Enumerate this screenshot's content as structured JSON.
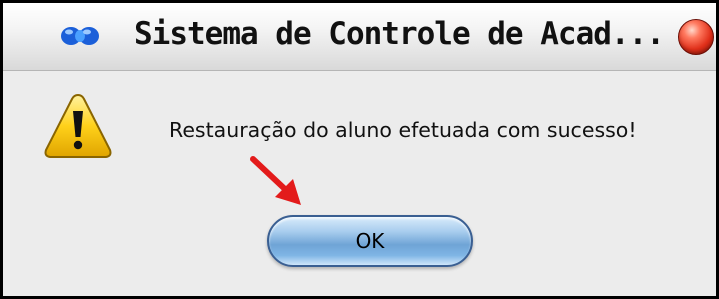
{
  "window": {
    "title": "Sistema de Controle de Acad...",
    "app_icon": "app-logo-icon",
    "close_icon": "close-icon"
  },
  "dialog": {
    "icon": "warning-icon",
    "message": "Restauração do aluno efetuada com sucesso!",
    "ok_label": "OK"
  },
  "annotation": {
    "arrow_icon": "red-arrow-icon",
    "arrow_color": "#e31b1b"
  },
  "colors": {
    "frame_border": "#000000",
    "dialog_background": "#ececec",
    "button_blue": "#6fa4d6",
    "close_red": "#e0301a",
    "warning_yellow": "#ffd11a"
  }
}
